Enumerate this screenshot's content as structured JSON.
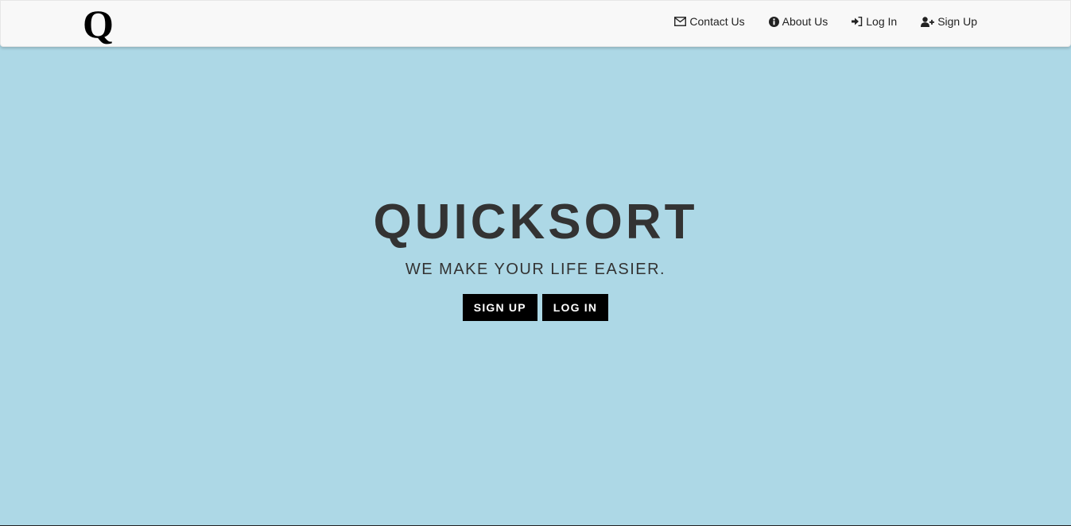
{
  "navbar": {
    "brand": "Q",
    "links": [
      {
        "label": "Contact Us",
        "icon": "envelope-icon"
      },
      {
        "label": "About Us",
        "icon": "info-circle-icon"
      },
      {
        "label": "Log In",
        "icon": "sign-in-icon"
      },
      {
        "label": "Sign Up",
        "icon": "user-plus-icon"
      }
    ]
  },
  "hero": {
    "title": "QUICKSORT",
    "subtitle": "WE MAKE YOUR LIFE EASIER.",
    "signup_label": "SIGN UP",
    "login_label": "LOG IN"
  },
  "colors": {
    "background": "#add8e6",
    "navbar": "#f8f8f8",
    "text": "#333333",
    "button": "#000000"
  }
}
